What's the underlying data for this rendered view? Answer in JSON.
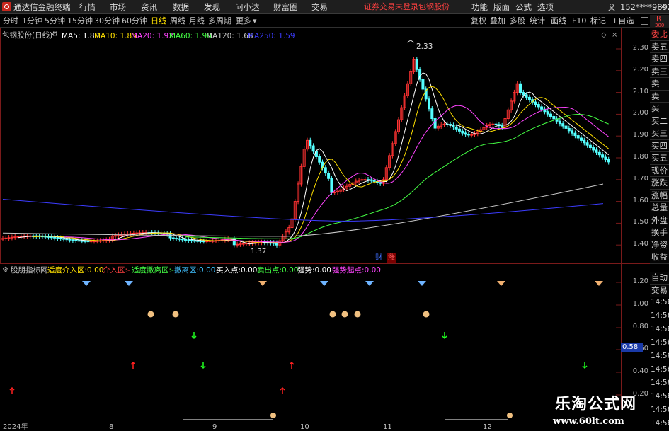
{
  "app": {
    "title": "通达信金融终端",
    "menu": [
      "行情",
      "市场",
      "资讯",
      "数据",
      "发现",
      "问小达",
      "财富圈",
      "交易"
    ],
    "warning": "证券交易未登录",
    "stock_name": "包钢股份",
    "right_menu": [
      "功能",
      "版面",
      "公式",
      "选项"
    ],
    "user": "152****9892",
    "window_buttons": [
      "−",
      "□",
      "×"
    ]
  },
  "periods": [
    {
      "label": "分时",
      "active": false
    },
    {
      "label": "1分钟",
      "active": false
    },
    {
      "label": "5分钟",
      "active": false
    },
    {
      "label": "15分钟",
      "active": false
    },
    {
      "label": "30分钟",
      "active": false
    },
    {
      "label": "60分钟",
      "active": false
    },
    {
      "label": "日线",
      "active": true
    },
    {
      "label": "周线",
      "active": false
    },
    {
      "label": "月线",
      "active": false
    },
    {
      "label": "多周期",
      "active": false
    },
    {
      "label": "更多",
      "active": false
    }
  ],
  "toolbar": [
    "复权",
    "叠加",
    "多股",
    "统计",
    "画线",
    "F10",
    "标记",
    "+自选"
  ],
  "main_chart": {
    "label": "包钢股份(日线)",
    "ma_legend": [
      {
        "name": "MA5",
        "value": "1.80",
        "color": "#ffffff"
      },
      {
        "name": "MA10",
        "value": "1.85",
        "color": "#ffe000"
      },
      {
        "name": "MA20",
        "value": "1.92",
        "color": "#ff44ff"
      },
      {
        "name": "MA60",
        "value": "1.90",
        "color": "#44ff44"
      },
      {
        "name": "MA120",
        "value": "1.68",
        "color": "#c8c8c8"
      },
      {
        "name": "MA250",
        "value": "1.59",
        "color": "#3c3cff"
      }
    ],
    "high_label": "2.33",
    "low_label": "1.37",
    "y_ticks": [
      "2.30",
      "2.20",
      "2.10",
      "2.00",
      "1.90",
      "1.80",
      "1.70",
      "1.60",
      "1.50",
      "1.40"
    ],
    "badges": [
      {
        "text": "财",
        "color": "#2050ff"
      },
      {
        "text": "涨",
        "color": "#ff4040"
      }
    ]
  },
  "indicator": {
    "name": "股朋指标网",
    "fields": [
      {
        "label": "适度介入区:",
        "value": "0.00",
        "color": "#ffe000"
      },
      {
        "label": "介入区:",
        "value": "-",
        "color": "#ff4040"
      },
      {
        "label": "适度撤离区:",
        "value": "-",
        "color": "#44ff44"
      },
      {
        "label": "撤离区:",
        "value": "0.00",
        "color": "#40c0ff"
      },
      {
        "label": "买入点:",
        "value": "0.00",
        "color": "#ffffff"
      },
      {
        "label": "卖出点:",
        "value": "0.00",
        "color": "#44ff44"
      },
      {
        "label": "强势:",
        "value": "0.00",
        "color": "#ffffff"
      },
      {
        "label": "强势起点:",
        "value": "0.00",
        "color": "#ff44ff"
      }
    ],
    "y_ticks": [
      "1.20",
      "1.00",
      "0.80",
      "0.60",
      "0.40",
      "0.20"
    ],
    "current_value": "0.58"
  },
  "x_axis": [
    "2024年",
    "8",
    "9",
    "10",
    "11",
    "12"
  ],
  "side_panel": {
    "quote_rows": [
      "委比",
      "卖五",
      "卖四",
      "卖三",
      "卖二",
      "卖一",
      "买一",
      "买二",
      "买三",
      "买四",
      "买五",
      "现价",
      "涨跌",
      "涨幅",
      "总量",
      "外盘",
      "换手",
      "净资",
      "收益"
    ],
    "trade_rows": [
      "自动",
      "交易"
    ],
    "times": [
      "14:56",
      "14:56",
      "14:56",
      "14:56",
      "14:56",
      "14:56",
      "14:56",
      "14:56",
      "14:56",
      "14:56"
    ],
    "r_badge": "R",
    "r_sub": "300"
  },
  "watermark": {
    "title": "乐淘公式网",
    "url": "www.60lt.com"
  },
  "colors": {
    "up": "#ff3232",
    "down": "#54ffff",
    "background": "#000000",
    "accent": "#ffe000"
  }
}
